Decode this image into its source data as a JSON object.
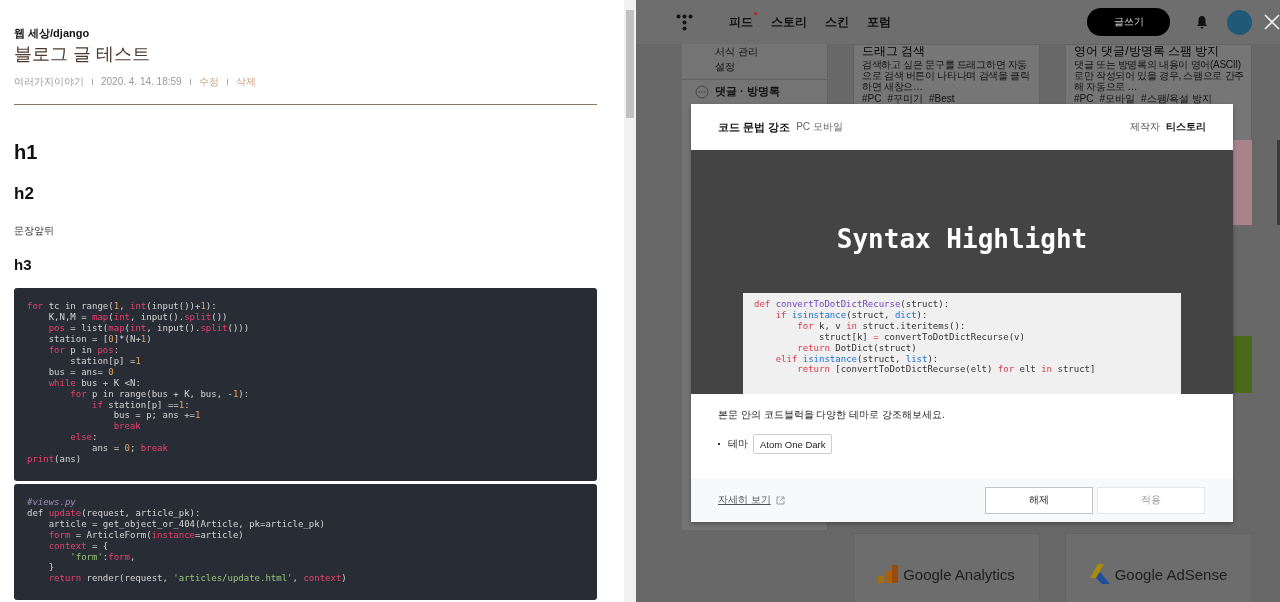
{
  "post": {
    "category": "웹 세상/django",
    "title": "블로그 글 테스트",
    "meta": [
      {
        "text": "여러가지이야기",
        "kind": "info"
      },
      {
        "text": "2020. 4. 14. 18:59",
        "kind": "info"
      },
      {
        "text": "수정",
        "kind": "action"
      },
      {
        "text": "삭제",
        "kind": "action"
      }
    ],
    "content": [
      {
        "kind": "h1",
        "text": "h1"
      },
      {
        "kind": "h2",
        "text": "h2"
      },
      {
        "kind": "paragraph",
        "text": "문장앞뒤"
      },
      {
        "kind": "h3",
        "text": "h3"
      },
      {
        "kind": "code",
        "lines": [
          [
            {
              "text": "for",
              "kind": "keyword"
            },
            {
              "text": " tc in range(",
              "kind": "plain"
            },
            {
              "text": "1",
              "kind": "number"
            },
            {
              "text": ", ",
              "kind": "plain"
            },
            {
              "text": "int",
              "kind": "keyword"
            },
            {
              "text": "(input())+",
              "kind": "plain"
            },
            {
              "text": "1",
              "kind": "number"
            },
            {
              "text": "):",
              "kind": "plain"
            }
          ],
          [
            {
              "text": "    K,N,M = ",
              "kind": "plain"
            },
            {
              "text": "map",
              "kind": "keyword"
            },
            {
              "text": "(",
              "kind": "plain"
            },
            {
              "text": "int",
              "kind": "keyword"
            },
            {
              "text": ", input().",
              "kind": "plain"
            },
            {
              "text": "split",
              "kind": "keyword"
            },
            {
              "text": "())",
              "kind": "plain"
            }
          ],
          [
            {
              "text": "    pos",
              "kind": "keyword"
            },
            {
              "text": " = list(",
              "kind": "plain"
            },
            {
              "text": "map",
              "kind": "keyword"
            },
            {
              "text": "(",
              "kind": "plain"
            },
            {
              "text": "int",
              "kind": "keyword"
            },
            {
              "text": ", input().",
              "kind": "plain"
            },
            {
              "text": "split",
              "kind": "keyword"
            },
            {
              "text": "()))",
              "kind": "plain"
            }
          ],
          [
            {
              "text": "    station = [",
              "kind": "plain"
            },
            {
              "text": "0",
              "kind": "number"
            },
            {
              "text": "]*(N+",
              "kind": "plain"
            },
            {
              "text": "1",
              "kind": "number"
            },
            {
              "text": ")",
              "kind": "plain"
            }
          ],
          [
            {
              "text": "    for",
              "kind": "keyword"
            },
            {
              "text": " p in ",
              "kind": "plain"
            },
            {
              "text": "pos",
              "kind": "keyword"
            },
            {
              "text": ":",
              "kind": "plain"
            }
          ],
          [
            {
              "text": "        station[p] =",
              "kind": "plain"
            },
            {
              "text": "1",
              "kind": "number"
            }
          ],
          [
            {
              "text": "    bus = ans= ",
              "kind": "plain"
            },
            {
              "text": "0",
              "kind": "number"
            }
          ],
          [
            {
              "text": "    while",
              "kind": "keyword"
            },
            {
              "text": " bus + K <N:",
              "kind": "plain"
            }
          ],
          [
            {
              "text": "        for",
              "kind": "keyword"
            },
            {
              "text": " p in range(bus + K, bus, -",
              "kind": "plain"
            },
            {
              "text": "1",
              "kind": "number"
            },
            {
              "text": "):",
              "kind": "plain"
            }
          ],
          [
            {
              "text": "            if",
              "kind": "keyword"
            },
            {
              "text": " station[p] ==",
              "kind": "plain"
            },
            {
              "text": "1",
              "kind": "number"
            },
            {
              "text": ":",
              "kind": "plain"
            }
          ],
          [
            {
              "text": "                bus = p; ans +=",
              "kind": "plain"
            },
            {
              "text": "1",
              "kind": "number"
            }
          ],
          [
            {
              "text": "                break",
              "kind": "keyword"
            }
          ],
          [
            {
              "text": "        else",
              "kind": "keyword"
            },
            {
              "text": ":",
              "kind": "plain"
            }
          ],
          [
            {
              "text": "            ans = ",
              "kind": "plain"
            },
            {
              "text": "0",
              "kind": "number"
            },
            {
              "text": "; ",
              "kind": "plain"
            },
            {
              "text": "break",
              "kind": "keyword"
            }
          ],
          [
            {
              "text": "print",
              "kind": "keyword"
            },
            {
              "text": "(ans)",
              "kind": "plain"
            }
          ]
        ]
      },
      {
        "kind": "code",
        "lines": [
          [
            {
              "text": "#views.py",
              "kind": "comment"
            }
          ],
          [
            {
              "text": "def ",
              "kind": "plain"
            },
            {
              "text": "update",
              "kind": "keyword"
            },
            {
              "text": "(request, article_pk):",
              "kind": "plain"
            }
          ],
          [
            {
              "text": "    article = get_object_or_404(Article, pk=article_pk)",
              "kind": "plain"
            }
          ],
          [
            {
              "text": "    form",
              "kind": "keyword"
            },
            {
              "text": " = ArticleForm(",
              "kind": "plain"
            },
            {
              "text": "instance",
              "kind": "keyword"
            },
            {
              "text": "=article)",
              "kind": "plain"
            }
          ],
          [
            {
              "text": "    context",
              "kind": "keyword"
            },
            {
              "text": " = {",
              "kind": "plain"
            }
          ],
          [
            {
              "text": "        'form'",
              "kind": "string"
            },
            {
              "text": ":",
              "kind": "plain"
            },
            {
              "text": "form",
              "kind": "keyword"
            },
            {
              "text": ",",
              "kind": "plain"
            }
          ],
          [
            {
              "text": "    }",
              "kind": "plain"
            }
          ],
          [
            {
              "text": "    return",
              "kind": "keyword"
            },
            {
              "text": " render(request, ",
              "kind": "plain"
            },
            {
              "text": "'articles/update.html'",
              "kind": "string"
            },
            {
              "text": ", ",
              "kind": "plain"
            },
            {
              "text": "context",
              "kind": "keyword"
            },
            {
              "text": ")",
              "kind": "plain"
            }
          ]
        ]
      }
    ]
  },
  "store": {
    "nav": [
      {
        "label": "피드",
        "badge": true
      },
      {
        "label": "스토리",
        "badge": false
      },
      {
        "label": "스킨",
        "badge": false
      },
      {
        "label": "포럼",
        "badge": false
      }
    ],
    "write_button": "글쓰기",
    "sidebar": {
      "items": [
        "서식 관리",
        "설정"
      ],
      "section": "댓글 · 방명록"
    },
    "cards": [
      {
        "title": "드래그 검색",
        "description": "검색하고 싶은 문구를 드래그하면 자동으로 검색 버튼이 나타나며 검색을 클릭하면 새창으…",
        "tags": [
          "#PC",
          "#꾸미기",
          "#Best"
        ]
      },
      {
        "title": "영어 댓글/방명록 스팸 방지",
        "description": "댓글 또는 방명록의 내용이 영어(ASCII)로만 작성되어 있을 경우, 스팸으로 간주해 자동으로 …",
        "tags": [
          "#PC",
          "#모바일",
          "#스팸/욕설 방지"
        ]
      }
    ],
    "thumbnails": [
      {
        "color": "#a8838c"
      },
      {
        "color": "#3a3a3a"
      },
      {
        "color": "#4a6a1a"
      }
    ],
    "bottom_cards": [
      {
        "name": "Google Analytics",
        "kind": "analytics"
      },
      {
        "name": "Google AdSense",
        "kind": "adsense"
      }
    ]
  },
  "modal": {
    "title": "코드 문법 강조",
    "platforms": "PC 모바일",
    "maker_label": "제작자",
    "maker": "티스토리",
    "preview": {
      "heading": "Syntax Highlight",
      "lines": [
        [
          {
            "text": "def",
            "kind": "keyword"
          },
          {
            "text": " convertToDotDictRecurse",
            "kind": "function"
          },
          {
            "text": "(struct):",
            "kind": "plain"
          }
        ],
        [
          {
            "text": "    if",
            "kind": "keyword"
          },
          {
            "text": " isinstance",
            "kind": "builtin"
          },
          {
            "text": "(struct, ",
            "kind": "plain"
          },
          {
            "text": "dict",
            "kind": "builtin"
          },
          {
            "text": "):",
            "kind": "plain"
          }
        ],
        [
          {
            "text": "        for",
            "kind": "keyword"
          },
          {
            "text": " k, v ",
            "kind": "plain"
          },
          {
            "text": "in",
            "kind": "keyword"
          },
          {
            "text": " struct.iteritems():",
            "kind": "plain"
          }
        ],
        [
          {
            "text": "            struct[k] ",
            "kind": "plain"
          },
          {
            "text": "=",
            "kind": "keyword"
          },
          {
            "text": " convertToDotDictRecurse(v)",
            "kind": "plain"
          }
        ],
        [
          {
            "text": "        return",
            "kind": "keyword"
          },
          {
            "text": " DotDict(struct)",
            "kind": "plain"
          }
        ],
        [
          {
            "text": "    elif",
            "kind": "keyword"
          },
          {
            "text": " isinstance",
            "kind": "builtin"
          },
          {
            "text": "(struct, ",
            "kind": "plain"
          },
          {
            "text": "list",
            "kind": "builtin"
          },
          {
            "text": "):",
            "kind": "plain"
          }
        ],
        [
          {
            "text": "        return",
            "kind": "keyword"
          },
          {
            "text": " [convertToDotDictRecurse(elt) ",
            "kind": "plain"
          },
          {
            "text": "for",
            "kind": "keyword"
          },
          {
            "text": " elt ",
            "kind": "plain"
          },
          {
            "text": "in",
            "kind": "keyword"
          },
          {
            "text": " struct]",
            "kind": "plain"
          }
        ]
      ]
    },
    "description": "본문 안의 코드블럭을 다양한 테마로 강조해보세요.",
    "option": {
      "label": "테마",
      "value": "Atom One Dark"
    },
    "link": "자세히 보기",
    "buttons": [
      {
        "label": "해제",
        "disabled": false
      },
      {
        "label": "적용",
        "disabled": true
      }
    ]
  }
}
